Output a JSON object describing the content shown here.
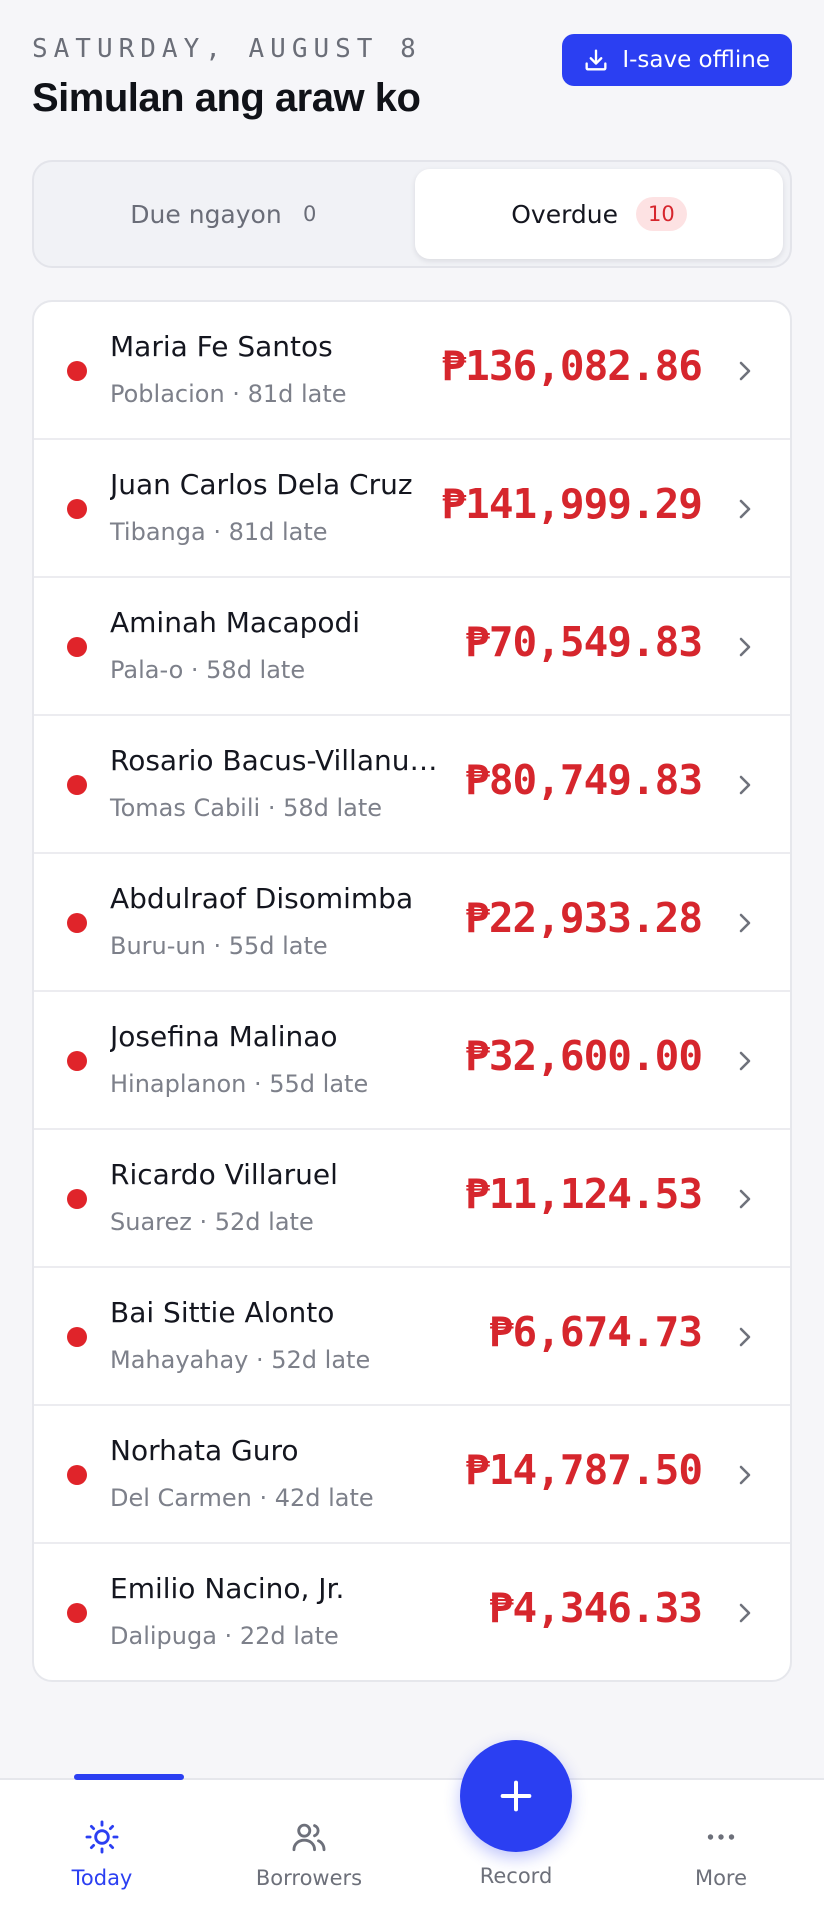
{
  "header": {
    "date": "SATURDAY, AUGUST 8",
    "title": "Simulan ang araw ko",
    "offline_button": "I-save offline"
  },
  "tabs": [
    {
      "label": "Due ngayon",
      "count": "0",
      "active": false
    },
    {
      "label": "Overdue",
      "count": "10",
      "active": true
    }
  ],
  "borrowers": [
    {
      "name": "Maria Fe Santos",
      "location": "Poblacion",
      "late": "81d late",
      "amount": "₱136,082.86"
    },
    {
      "name": "Juan Carlos Dela Cruz",
      "location": "Tibanga",
      "late": "81d late",
      "amount": "₱141,999.29"
    },
    {
      "name": "Aminah Macapodi",
      "location": "Pala-o",
      "late": "58d late",
      "amount": "₱70,549.83"
    },
    {
      "name": "Rosario Bacus-Villanueva",
      "location": "Tomas Cabili",
      "late": "58d late",
      "amount": "₱80,749.83"
    },
    {
      "name": "Abdulraof Disomimba",
      "location": "Buru-un",
      "late": "55d late",
      "amount": "₱22,933.28"
    },
    {
      "name": "Josefina Malinao",
      "location": "Hinaplanon",
      "late": "55d late",
      "amount": "₱32,600.00"
    },
    {
      "name": "Ricardo Villaruel",
      "location": "Suarez",
      "late": "52d late",
      "amount": "₱11,124.53"
    },
    {
      "name": "Bai Sittie Alonto",
      "location": "Mahayahay",
      "late": "52d late",
      "amount": "₱6,674.73"
    },
    {
      "name": "Norhata Guro",
      "location": "Del Carmen",
      "late": "42d late",
      "amount": "₱14,787.50"
    },
    {
      "name": "Emilio Nacino, Jr.",
      "location": "Dalipuga",
      "late": "22d late",
      "amount": "₱4,346.33"
    }
  ],
  "nav": {
    "today": "Today",
    "borrowers": "Borrowers",
    "record": "Record",
    "more": "More"
  },
  "icons": {
    "offline": "download-icon",
    "today": "sun-icon",
    "borrowers": "users-icon",
    "record": "plus-icon",
    "more": "more-horizontal-icon",
    "row": "chevron-right-icon",
    "status": "overdue-dot"
  },
  "colors": {
    "accent": "#2b3ff2",
    "overdue": "#d6262d",
    "badge_bg": "#fde2e3"
  }
}
